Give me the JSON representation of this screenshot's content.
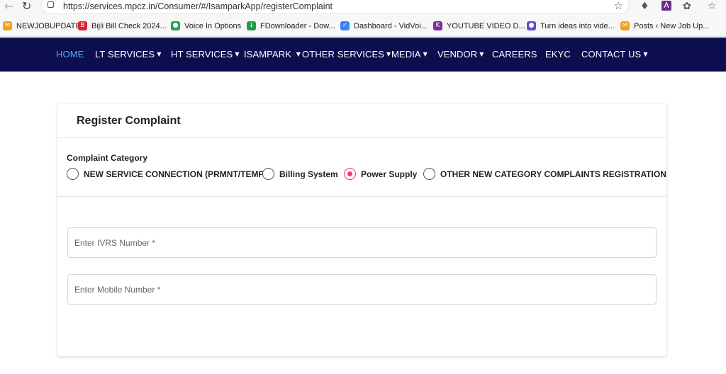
{
  "browser": {
    "url": "https://services.mpcz.in/Consumer/#/IsamparkApp/registerComplaint",
    "bookmarks": [
      {
        "label": "NEWJOBUPDATE",
        "color": "#f0a020",
        "glyph": "✉"
      },
      {
        "label": "Bijli Bill Check 2024...",
        "color": "#d9232d",
        "glyph": "B"
      },
      {
        "label": "Voice In Options",
        "color": "#27a05a",
        "glyph": "●"
      },
      {
        "label": "FDownloader - Dow...",
        "color": "#1f9d4a",
        "glyph": "↓"
      },
      {
        "label": "Dashboard - VidVoi...",
        "color": "#3b82f6",
        "glyph": "✓"
      },
      {
        "label": "YOUTUBE VIDEO D...",
        "color": "#7b2fa0",
        "glyph": "K"
      },
      {
        "label": "Turn ideas into vide...",
        "color": "#5b4fd6",
        "glyph": "●"
      },
      {
        "label": "Posts ‹ New Job Up...",
        "color": "#f0a020",
        "glyph": "✉"
      }
    ]
  },
  "nav": {
    "items": [
      {
        "label": "HOME",
        "dropdown": false,
        "active": true
      },
      {
        "label": "LT SERVICES",
        "dropdown": true
      },
      {
        "label": "HT SERVICES",
        "dropdown": true
      },
      {
        "label": "ISAMPARK",
        "dropdown": true
      },
      {
        "label": "OTHER SERVICES",
        "dropdown": true
      },
      {
        "label": "MEDIA",
        "dropdown": true
      },
      {
        "label": "VENDOR",
        "dropdown": true
      },
      {
        "label": "CAREERS",
        "dropdown": false
      },
      {
        "label": "EKYC",
        "dropdown": false
      },
      {
        "label": "CONTACT US",
        "dropdown": true
      }
    ]
  },
  "form": {
    "title": "Register Complaint",
    "category_label": "Complaint Category",
    "options": [
      {
        "label": "NEW SERVICE CONNECTION (PRMNT/TEMP)",
        "checked": false
      },
      {
        "label": "Billing System",
        "checked": false
      },
      {
        "label": "Power Supply",
        "checked": true
      },
      {
        "label": "OTHER NEW CATEGORY COMPLAINTS REGISTRATION",
        "checked": false
      }
    ],
    "ivrs": {
      "placeholder": "Enter IVRS Number *",
      "value": ""
    },
    "mobile": {
      "placeholder": "Enter Mobile Number *",
      "value": ""
    }
  },
  "colors": {
    "nav_bg": "#0c0e50",
    "nav_active": "#4fb0e8",
    "radio_checked": "#e83e6b"
  }
}
